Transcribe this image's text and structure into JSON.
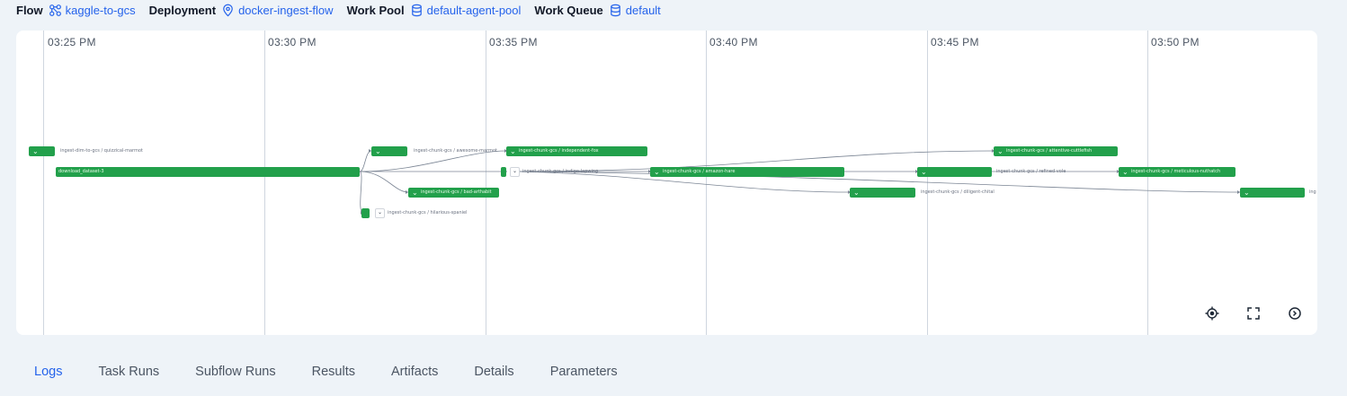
{
  "meta": {
    "flow_label": "Flow",
    "flow_value": "kaggle-to-gcs",
    "deployment_label": "Deployment",
    "deployment_value": "docker-ingest-flow",
    "work_pool_label": "Work Pool",
    "work_pool_value": "default-agent-pool",
    "work_queue_label": "Work Queue",
    "work_queue_value": "default"
  },
  "timeline": {
    "ticks": [
      "03:25 PM",
      "03:30 PM",
      "03:35 PM",
      "03:40 PM",
      "03:45 PM",
      "03:50 PM"
    ],
    "nodes": {
      "n1_label": "ingest-dim-to-gcs / quizzical-marmot",
      "n2_label": "download_dataset-3",
      "n3_label": "ingest-chunk-gcs / awesome-marmot",
      "n4_label": "ingest-chunk-gcs / bad-arthabit",
      "n5_label": "ingest-chunk-gcs / hilarious-spaniel",
      "n6_label": "ingest-chunk-gcs / independent-fox",
      "n7_label": "ingest-chunk-gcs / indigo-lapwing",
      "n8_label": "ingest-chunk-gcs / amazon-hare",
      "n9_label": "ingest-chunk-gcs / attentive-cuttlefish",
      "n10_label": "ingest-chunk-gcs / refined-vole",
      "n11_label": "ingest-chunk-gcs / meticulous-nuthatch",
      "n12_label": "ingest-chunk-gcs / diligent-chital",
      "n13_label": "ing"
    }
  },
  "controls": {
    "recenter_icon": "crosshair-icon",
    "fullscreen_icon": "expand-icon",
    "options_icon": "chevron-circle-icon"
  },
  "tabs": {
    "logs": "Logs",
    "task_runs": "Task Runs",
    "subflow_runs": "Subflow Runs",
    "results": "Results",
    "artifacts": "Artifacts",
    "details": "Details",
    "parameters": "Parameters"
  },
  "colors": {
    "accent": "#2563eb",
    "node_completed": "#22a04b",
    "background": "#eef3f8"
  }
}
